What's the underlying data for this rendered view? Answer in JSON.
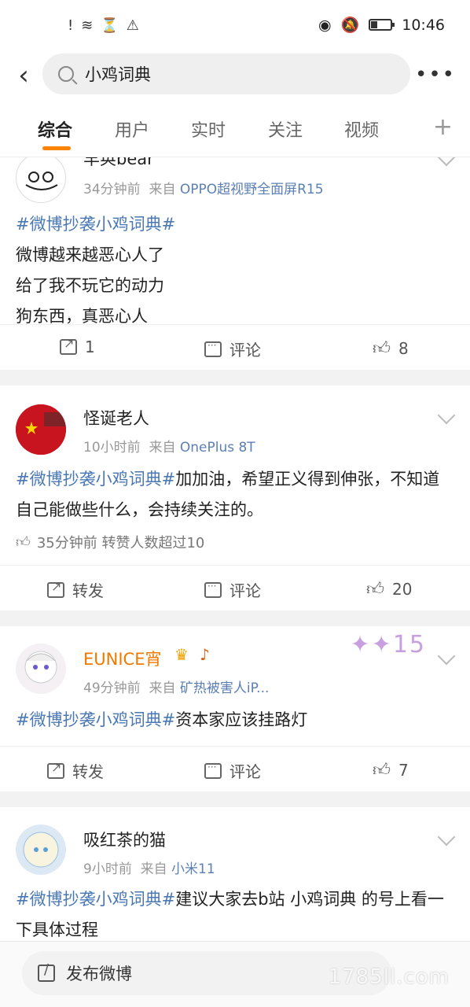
{
  "status": {
    "time": "10:46",
    "left_icons": [
      "!",
      "wifi",
      "⏳",
      "⚠"
    ],
    "battery_level": 0.3
  },
  "search": {
    "query": "小鸡词典"
  },
  "tabs": [
    "综合",
    "用户",
    "实时",
    "关注",
    "视频"
  ],
  "posts": [
    {
      "name": "羊奂bear",
      "time": "34分钟前",
      "from_label": "来自",
      "source": "OPPO超视野全面屏R15",
      "tag": "#微博抄袭小鸡词典#",
      "lines": [
        "微博越来越恶心人了",
        "给了我不玩它的动力",
        "狗东西，真恶心人"
      ],
      "share": "1",
      "comment": "评论",
      "like": "8"
    },
    {
      "name": "怪诞老人",
      "time": "10小时前",
      "from_label": "来自",
      "source": "OnePlus 8T",
      "tag": "#微博抄袭小鸡词典#",
      "text": "加加油，希望正义得到伸张，不知道自己能做些什么，会持续关注的。",
      "like_note": "35分钟前 转赞人数超过10",
      "share": "转发",
      "comment": "评论",
      "like": "20"
    },
    {
      "name": "EUNICE宵",
      "time": "49分钟前",
      "from_label": "来自",
      "source": "矿热被害人iP...",
      "tag": "#微博抄袭小鸡词典#",
      "text": "资本家应该挂路灯",
      "share": "转发",
      "comment": "评论",
      "like": "7"
    },
    {
      "name": "吸红茶的猫",
      "time": "9小时前",
      "from_label": "来自",
      "source": "小米11",
      "tag": "#微博抄袭小鸡词典#",
      "text": "建议大家去b站 小鸡词典 的号上看一下具体过程"
    }
  ],
  "bottom": {
    "compose": "发布微博",
    "watermark": "1785ll.com"
  }
}
